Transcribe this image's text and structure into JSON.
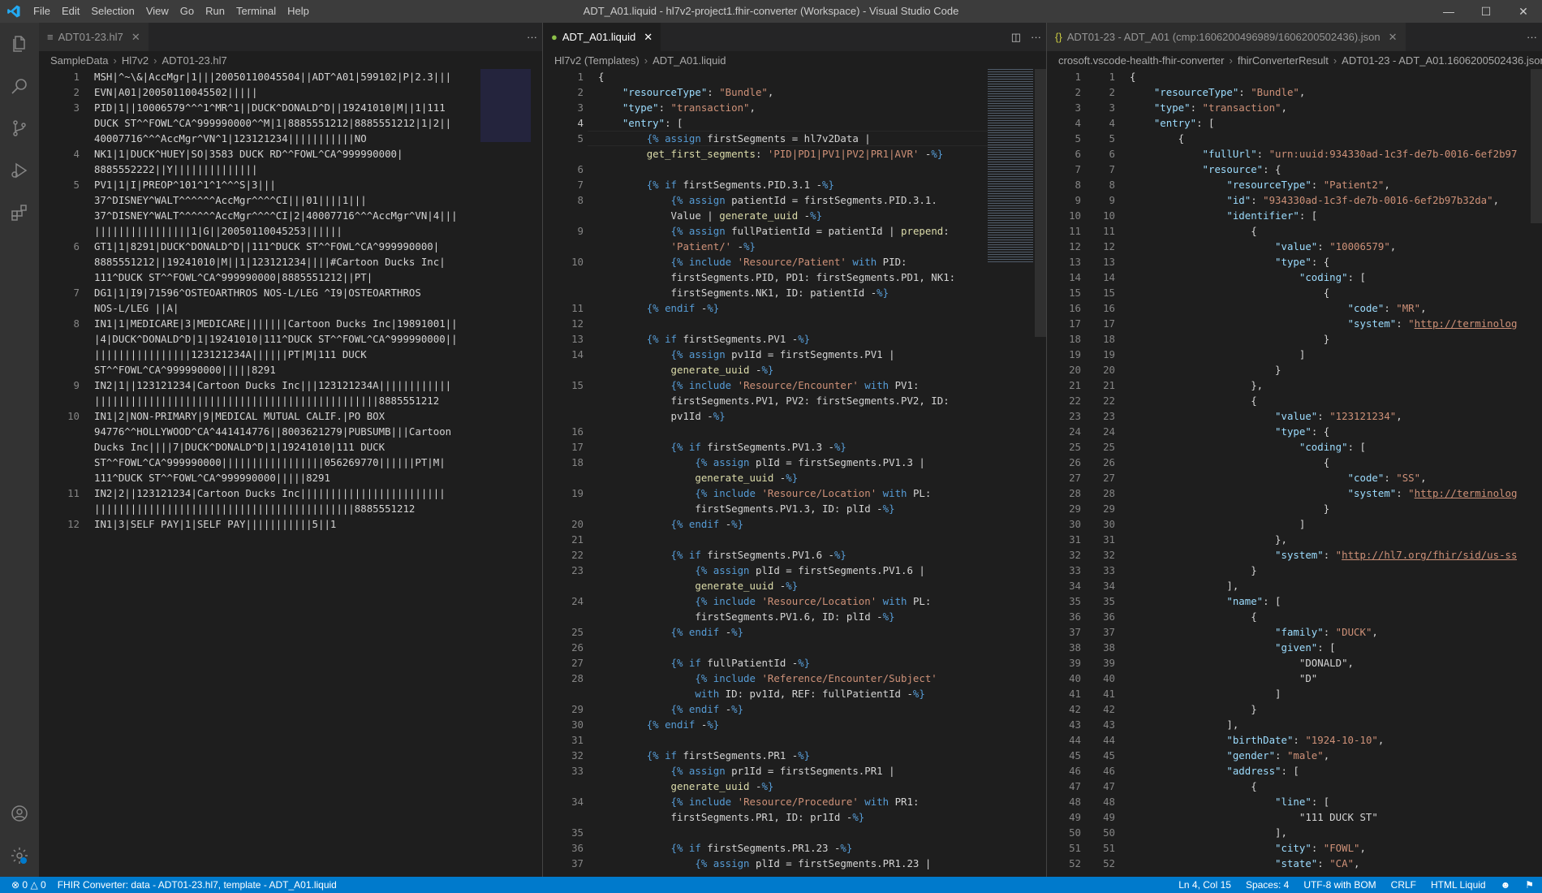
{
  "titlebar": {
    "menu": [
      "File",
      "Edit",
      "Selection",
      "View",
      "Go",
      "Run",
      "Terminal",
      "Help"
    ],
    "title": "ADT_A01.liquid - hl7v2-project1.fhir-converter (Workspace) - Visual Studio Code"
  },
  "editor1": {
    "tab_label": "ADT01-23.hl7",
    "breadcrumb": [
      "SampleData",
      "Hl7v2",
      "ADT01-23.hl7"
    ],
    "lines": [
      {
        "n": "1",
        "t": "MSH|^~\\&|AccMgr|1|||20050110045504||ADT^A01|599102|P|2.3|||"
      },
      {
        "n": "2",
        "t": "EVN|A01|20050110045502|||||"
      },
      {
        "n": "3",
        "t": "PID|1||10006579^^^1^MR^1||DUCK^DONALD^D||19241010|M||1|111"
      },
      {
        "n": "",
        "t": "DUCK ST^^FOWL^CA^999990000^^M|1|8885551212|8885551212|1|2||"
      },
      {
        "n": "",
        "t": "40007716^^^AccMgr^VN^1|123121234|||||||||||NO"
      },
      {
        "n": "4",
        "t": "NK1|1|DUCK^HUEY|SO|3583 DUCK RD^^FOWL^CA^999990000|"
      },
      {
        "n": "",
        "t": "8885552222||Y||||||||||||||"
      },
      {
        "n": "5",
        "t": "PV1|1|I|PREOP^101^1^1^^^S|3|||"
      },
      {
        "n": "",
        "t": "37^DISNEY^WALT^^^^^^AccMgr^^^^CI|||01||||1|||"
      },
      {
        "n": "",
        "t": "37^DISNEY^WALT^^^^^^AccMgr^^^^CI|2|40007716^^^AccMgr^VN|4|||"
      },
      {
        "n": "",
        "t": "||||||||||||||||1|G||20050110045253||||||"
      },
      {
        "n": "6",
        "t": "GT1|1|8291|DUCK^DONALD^D||111^DUCK ST^^FOWL^CA^999990000|"
      },
      {
        "n": "",
        "t": "8885551212||19241010|M||1|123121234||||#Cartoon Ducks Inc|"
      },
      {
        "n": "",
        "t": "111^DUCK ST^^FOWL^CA^999990000|8885551212||PT|"
      },
      {
        "n": "7",
        "t": "DG1|1|I9|71596^OSTEOARTHROS NOS-L/LEG ^I9|OSTEOARTHROS"
      },
      {
        "n": "",
        "t": "NOS-L/LEG ||A|"
      },
      {
        "n": "8",
        "t": "IN1|1|MEDICARE|3|MEDICARE|||||||Cartoon Ducks Inc|19891001||"
      },
      {
        "n": "",
        "t": "|4|DUCK^DONALD^D|1|19241010|111^DUCK ST^^FOWL^CA^999990000||"
      },
      {
        "n": "",
        "t": "||||||||||||||||123121234A||||||PT|M|111 DUCK"
      },
      {
        "n": "",
        "t": "ST^^FOWL^CA^999990000|||||8291"
      },
      {
        "n": "9",
        "t": "IN2|1||123121234|Cartoon Ducks Inc|||123121234A||||||||||||"
      },
      {
        "n": "",
        "t": "|||||||||||||||||||||||||||||||||||||||||||||||8885551212"
      },
      {
        "n": "10",
        "t": "IN1|2|NON-PRIMARY|9|MEDICAL MUTUAL CALIF.|PO BOX"
      },
      {
        "n": "",
        "t": "94776^^HOLLYWOOD^CA^441414776||8003621279|PUBSUMB|||Cartoon"
      },
      {
        "n": "",
        "t": "Ducks Inc||||7|DUCK^DONALD^D|1|19241010|111 DUCK"
      },
      {
        "n": "",
        "t": "ST^^FOWL^CA^999990000|||||||||||||||||056269770||||||PT|M|"
      },
      {
        "n": "",
        "t": "111^DUCK ST^^FOWL^CA^999990000|||||8291"
      },
      {
        "n": "11",
        "t": "IN2|2||123121234|Cartoon Ducks Inc||||||||||||||||||||||||"
      },
      {
        "n": "",
        "t": "|||||||||||||||||||||||||||||||||||||||||||8885551212"
      },
      {
        "n": "12",
        "t": "IN1|3|SELF PAY|1|SELF PAY|||||||||||5||1"
      }
    ]
  },
  "editor2": {
    "tab_label": "ADT_A01.liquid",
    "breadcrumb": [
      "Hl7v2 (Templates)",
      "ADT_A01.liquid"
    ],
    "lines": [
      {
        "n": "1",
        "t": "{"
      },
      {
        "n": "2",
        "t": "    \"resourceType\": \"Bundle\","
      },
      {
        "n": "3",
        "t": "    \"type\": \"transaction\","
      },
      {
        "n": "4",
        "t": "    \"entry\": ["
      },
      {
        "n": "5",
        "t": "        {% assign firstSegments = hl7v2Data |"
      },
      {
        "n": "",
        "t": "        get_first_segments: 'PID|PD1|PV1|PV2|PR1|AVR' -%}"
      },
      {
        "n": "6",
        "t": ""
      },
      {
        "n": "7",
        "t": "        {% if firstSegments.PID.3.1 -%}"
      },
      {
        "n": "8",
        "t": "            {% assign patientId = firstSegments.PID.3.1."
      },
      {
        "n": "",
        "t": "            Value | generate_uuid -%}"
      },
      {
        "n": "9",
        "t": "            {% assign fullPatientId = patientId | prepend:"
      },
      {
        "n": "",
        "t": "            'Patient/' -%}"
      },
      {
        "n": "10",
        "t": "            {% include 'Resource/Patient' with PID:"
      },
      {
        "n": "",
        "t": "            firstSegments.PID, PD1: firstSegments.PD1, NK1:"
      },
      {
        "n": "",
        "t": "            firstSegments.NK1, ID: patientId -%}"
      },
      {
        "n": "11",
        "t": "        {% endif -%}"
      },
      {
        "n": "12",
        "t": ""
      },
      {
        "n": "13",
        "t": "        {% if firstSegments.PV1 -%}"
      },
      {
        "n": "14",
        "t": "            {% assign pv1Id = firstSegments.PV1 |"
      },
      {
        "n": "",
        "t": "            generate_uuid -%}"
      },
      {
        "n": "15",
        "t": "            {% include 'Resource/Encounter' with PV1:"
      },
      {
        "n": "",
        "t": "            firstSegments.PV1, PV2: firstSegments.PV2, ID:"
      },
      {
        "n": "",
        "t": "            pv1Id -%}"
      },
      {
        "n": "16",
        "t": ""
      },
      {
        "n": "17",
        "t": "            {% if firstSegments.PV1.3 -%}"
      },
      {
        "n": "18",
        "t": "                {% assign plId = firstSegments.PV1.3 |"
      },
      {
        "n": "",
        "t": "                generate_uuid -%}"
      },
      {
        "n": "19",
        "t": "                {% include 'Resource/Location' with PL:"
      },
      {
        "n": "",
        "t": "                firstSegments.PV1.3, ID: plId -%}"
      },
      {
        "n": "20",
        "t": "            {% endif -%}"
      },
      {
        "n": "21",
        "t": ""
      },
      {
        "n": "22",
        "t": "            {% if firstSegments.PV1.6 -%}"
      },
      {
        "n": "23",
        "t": "                {% assign plId = firstSegments.PV1.6 |"
      },
      {
        "n": "",
        "t": "                generate_uuid -%}"
      },
      {
        "n": "24",
        "t": "                {% include 'Resource/Location' with PL:"
      },
      {
        "n": "",
        "t": "                firstSegments.PV1.6, ID: plId -%}"
      },
      {
        "n": "25",
        "t": "            {% endif -%}"
      },
      {
        "n": "26",
        "t": ""
      },
      {
        "n": "27",
        "t": "            {% if fullPatientId -%}"
      },
      {
        "n": "28",
        "t": "                {% include 'Reference/Encounter/Subject'"
      },
      {
        "n": "",
        "t": "                with ID: pv1Id, REF: fullPatientId -%}"
      },
      {
        "n": "29",
        "t": "            {% endif -%}"
      },
      {
        "n": "30",
        "t": "        {% endif -%}"
      },
      {
        "n": "31",
        "t": ""
      },
      {
        "n": "32",
        "t": "        {% if firstSegments.PR1 -%}"
      },
      {
        "n": "33",
        "t": "            {% assign pr1Id = firstSegments.PR1 |"
      },
      {
        "n": "",
        "t": "            generate_uuid -%}"
      },
      {
        "n": "34",
        "t": "            {% include 'Resource/Procedure' with PR1:"
      },
      {
        "n": "",
        "t": "            firstSegments.PR1, ID: pr1Id -%}"
      },
      {
        "n": "35",
        "t": ""
      },
      {
        "n": "36",
        "t": "            {% if firstSegments.PR1.23 -%}"
      },
      {
        "n": "37",
        "t": "                {% assign plId = firstSegments.PR1.23 |"
      }
    ]
  },
  "editor3": {
    "tab_label": "ADT01-23 - ADT_A01 (cmp:1606200496989/1606200502436).json",
    "breadcrumb": [
      "crosoft.vscode-health-fhir-converter",
      "fhirConverterResult",
      "ADT01-23 - ADT_A01.1606200502436.jsor"
    ],
    "lines": [
      {
        "a": "1",
        "b": "1",
        "t": "{"
      },
      {
        "a": "2",
        "b": "2",
        "t": "    \"resourceType\": \"Bundle\","
      },
      {
        "a": "3",
        "b": "3",
        "t": "    \"type\": \"transaction\","
      },
      {
        "a": "4",
        "b": "4",
        "t": "    \"entry\": ["
      },
      {
        "a": "5",
        "b": "5",
        "t": "        {"
      },
      {
        "a": "6",
        "b": "6",
        "t": "            \"fullUrl\": \"urn:uuid:934330ad-1c3f-de7b-0016-6ef2b97"
      },
      {
        "a": "7",
        "b": "7",
        "t": "            \"resource\": {"
      },
      {
        "a": "8",
        "b": "8",
        "t": "                \"resourceType\": \"Patient2\","
      },
      {
        "a": "9",
        "b": "9",
        "t": "                \"id\": \"934330ad-1c3f-de7b-0016-6ef2b97b32da\","
      },
      {
        "a": "10",
        "b": "10",
        "t": "                \"identifier\": ["
      },
      {
        "a": "11",
        "b": "11",
        "t": "                    {"
      },
      {
        "a": "12",
        "b": "12",
        "t": "                        \"value\": \"10006579\","
      },
      {
        "a": "13",
        "b": "13",
        "t": "                        \"type\": {"
      },
      {
        "a": "14",
        "b": "14",
        "t": "                            \"coding\": ["
      },
      {
        "a": "15",
        "b": "15",
        "t": "                                {"
      },
      {
        "a": "16",
        "b": "16",
        "t": "                                    \"code\": \"MR\","
      },
      {
        "a": "17",
        "b": "17",
        "t": "                                    \"system\": \"http://terminolog"
      },
      {
        "a": "18",
        "b": "18",
        "t": "                                }"
      },
      {
        "a": "19",
        "b": "19",
        "t": "                            ]"
      },
      {
        "a": "20",
        "b": "20",
        "t": "                        }"
      },
      {
        "a": "21",
        "b": "21",
        "t": "                    },"
      },
      {
        "a": "22",
        "b": "22",
        "t": "                    {"
      },
      {
        "a": "23",
        "b": "23",
        "t": "                        \"value\": \"123121234\","
      },
      {
        "a": "24",
        "b": "24",
        "t": "                        \"type\": {"
      },
      {
        "a": "25",
        "b": "25",
        "t": "                            \"coding\": ["
      },
      {
        "a": "26",
        "b": "26",
        "t": "                                {"
      },
      {
        "a": "27",
        "b": "27",
        "t": "                                    \"code\": \"SS\","
      },
      {
        "a": "28",
        "b": "28",
        "t": "                                    \"system\": \"http://terminolog"
      },
      {
        "a": "29",
        "b": "29",
        "t": "                                }"
      },
      {
        "a": "30",
        "b": "30",
        "t": "                            ]"
      },
      {
        "a": "31",
        "b": "31",
        "t": "                        },"
      },
      {
        "a": "32",
        "b": "32",
        "t": "                        \"system\": \"http://hl7.org/fhir/sid/us-ss"
      },
      {
        "a": "33",
        "b": "33",
        "t": "                    }"
      },
      {
        "a": "34",
        "b": "34",
        "t": "                ],"
      },
      {
        "a": "35",
        "b": "35",
        "t": "                \"name\": ["
      },
      {
        "a": "36",
        "b": "36",
        "t": "                    {"
      },
      {
        "a": "37",
        "b": "37",
        "t": "                        \"family\": \"DUCK\","
      },
      {
        "a": "38",
        "b": "38",
        "t": "                        \"given\": ["
      },
      {
        "a": "39",
        "b": "39",
        "t": "                            \"DONALD\","
      },
      {
        "a": "40",
        "b": "40",
        "t": "                            \"D\""
      },
      {
        "a": "41",
        "b": "41",
        "t": "                        ]"
      },
      {
        "a": "42",
        "b": "42",
        "t": "                    }"
      },
      {
        "a": "43",
        "b": "43",
        "t": "                ],"
      },
      {
        "a": "44",
        "b": "44",
        "t": "                \"birthDate\": \"1924-10-10\","
      },
      {
        "a": "45",
        "b": "45",
        "t": "                \"gender\": \"male\","
      },
      {
        "a": "46",
        "b": "46",
        "t": "                \"address\": ["
      },
      {
        "a": "47",
        "b": "47",
        "t": "                    {"
      },
      {
        "a": "48",
        "b": "48",
        "t": "                        \"line\": ["
      },
      {
        "a": "49",
        "b": "49",
        "t": "                            \"111 DUCK ST\""
      },
      {
        "a": "50",
        "b": "50",
        "t": "                        ],"
      },
      {
        "a": "51",
        "b": "51",
        "t": "                        \"city\": \"FOWL\","
      },
      {
        "a": "52",
        "b": "52",
        "t": "                        \"state\": \"CA\","
      }
    ]
  },
  "statusbar": {
    "problems": "0",
    "warnings": "0",
    "message": "FHIR Converter: data - ADT01-23.hl7, template - ADT_A01.liquid",
    "position": "Ln 4, Col 15",
    "spaces": "Spaces: 4",
    "encoding": "UTF-8 with BOM",
    "eol": "CRLF",
    "language": "HTML Liquid"
  },
  "colors": {
    "accent": "#007acc",
    "activity_bar": "#333333",
    "editor_bg": "#1e1e1e",
    "title_bar": "#3c3c3c"
  }
}
